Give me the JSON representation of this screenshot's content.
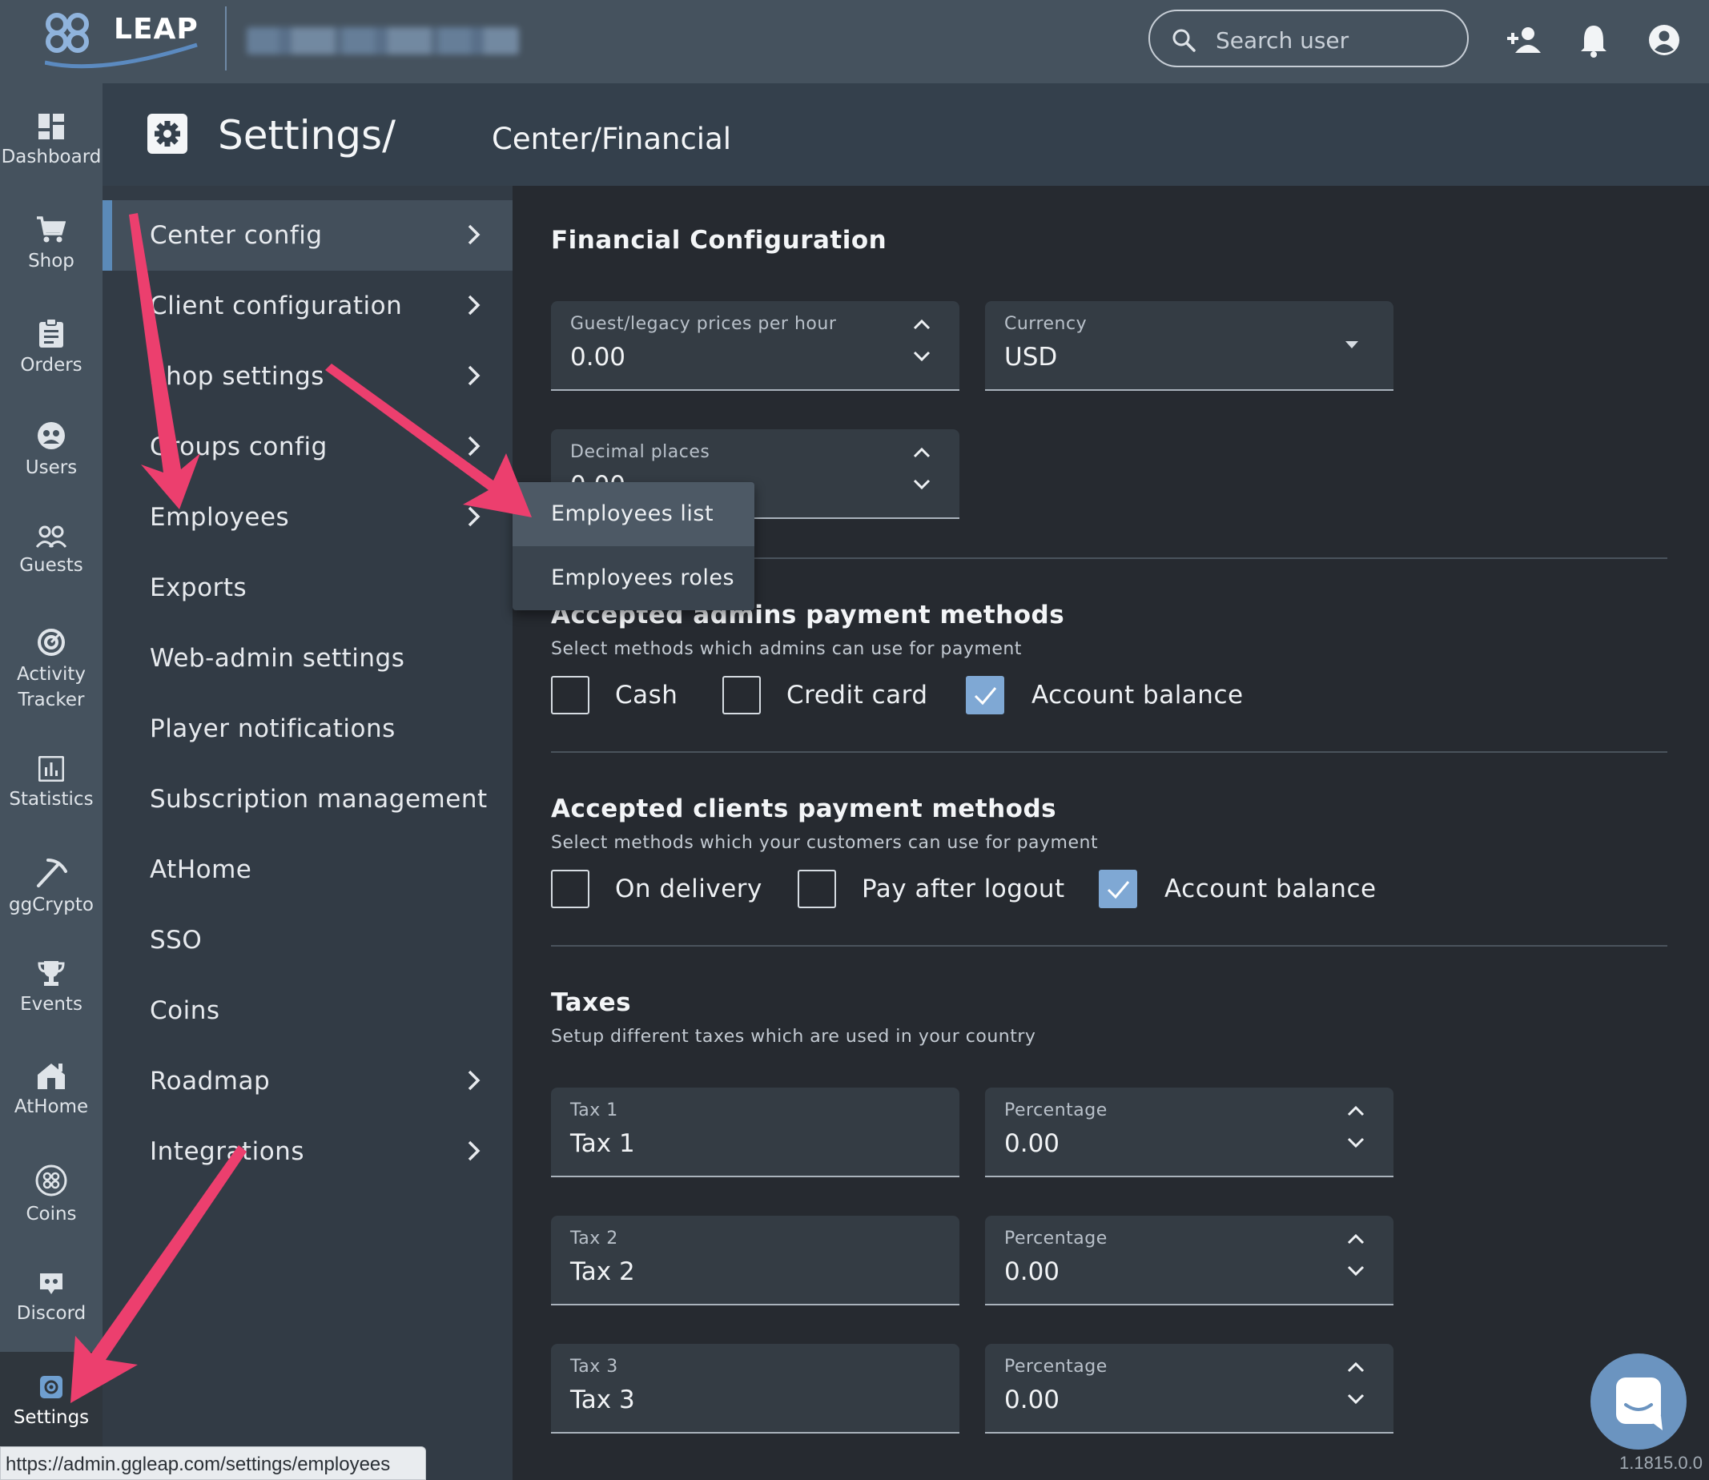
{
  "topbar": {
    "logo_text": "LEAP",
    "search_placeholder": "Search user"
  },
  "leftnav": {
    "items": [
      {
        "label": "Dashboard",
        "icon": "dashboard-icon"
      },
      {
        "label": "Shop",
        "icon": "cart-icon"
      },
      {
        "label": "Orders",
        "icon": "clipboard-icon"
      },
      {
        "label": "Users",
        "icon": "users-icon"
      },
      {
        "label": "Guests",
        "icon": "guests-icon"
      },
      {
        "label": "Activity Tracker",
        "icon": "activity-icon"
      },
      {
        "label": "Statistics",
        "icon": "statistics-icon"
      },
      {
        "label": "ggCrypto",
        "icon": "pickaxe-icon"
      },
      {
        "label": "Events",
        "icon": "trophy-icon"
      },
      {
        "label": "AtHome",
        "icon": "home-icon"
      },
      {
        "label": "Coins",
        "icon": "coins-icon"
      },
      {
        "label": "Discord",
        "icon": "discord-icon"
      },
      {
        "label": "Settings",
        "icon": "gear-icon"
      }
    ],
    "active": "Settings"
  },
  "header": {
    "crumb_main": "Settings/",
    "crumb_sub": "Center/Financial"
  },
  "settings_menu": {
    "items": [
      {
        "label": "Center config",
        "has_children": true,
        "active": true
      },
      {
        "label": "Client configuration",
        "has_children": true
      },
      {
        "label": "Shop settings",
        "has_children": true
      },
      {
        "label": "Groups config",
        "has_children": true
      },
      {
        "label": "Employees",
        "has_children": true
      },
      {
        "label": "Exports",
        "has_children": false
      },
      {
        "label": "Web-admin settings",
        "has_children": false
      },
      {
        "label": "Player notifications",
        "has_children": false
      },
      {
        "label": "Subscription management",
        "has_children": false
      },
      {
        "label": "AtHome",
        "has_children": false
      },
      {
        "label": "SSO",
        "has_children": false
      },
      {
        "label": "Coins",
        "has_children": false
      },
      {
        "label": "Roadmap",
        "has_children": true
      },
      {
        "label": "Integrations",
        "has_children": true
      }
    ]
  },
  "popup": {
    "items": [
      "Employees list",
      "Employees roles"
    ],
    "highlighted": "Employees list"
  },
  "financial": {
    "title": "Financial Configuration",
    "guest_prices": {
      "label": "Guest/legacy prices per hour",
      "value": "0.00"
    },
    "currency": {
      "label": "Currency",
      "value": "USD"
    },
    "decimal_places": {
      "label": "Decimal places",
      "value": "0.00"
    }
  },
  "admins_payment": {
    "title": "Accepted admins payment methods",
    "desc": "Select methods which admins can use for payment",
    "options": [
      {
        "label": "Cash",
        "checked": false
      },
      {
        "label": "Credit card",
        "checked": false
      },
      {
        "label": "Account balance",
        "checked": true
      }
    ]
  },
  "clients_payment": {
    "title": "Accepted clients payment methods",
    "desc": "Select methods which your customers can use for payment",
    "options": [
      {
        "label": "On delivery",
        "checked": false
      },
      {
        "label": "Pay after logout",
        "checked": false
      },
      {
        "label": "Account balance",
        "checked": true
      }
    ]
  },
  "taxes": {
    "title": "Taxes",
    "desc": "Setup different taxes which are used in your country",
    "rows": [
      {
        "name_label": "Tax 1",
        "name_value": "Tax 1",
        "pct_label": "Percentage",
        "pct_value": "0.00"
      },
      {
        "name_label": "Tax 2",
        "name_value": "Tax 2",
        "pct_label": "Percentage",
        "pct_value": "0.00"
      },
      {
        "name_label": "Tax 3",
        "name_value": "Tax 3",
        "pct_label": "Percentage",
        "pct_value": "0.00"
      }
    ]
  },
  "status_url": "https://admin.ggleap.com/settings/employees",
  "version": "1.1815.0.0",
  "colors": {
    "accent": "#7fa8d4",
    "annotation_arrow": "#ec3f6e"
  }
}
